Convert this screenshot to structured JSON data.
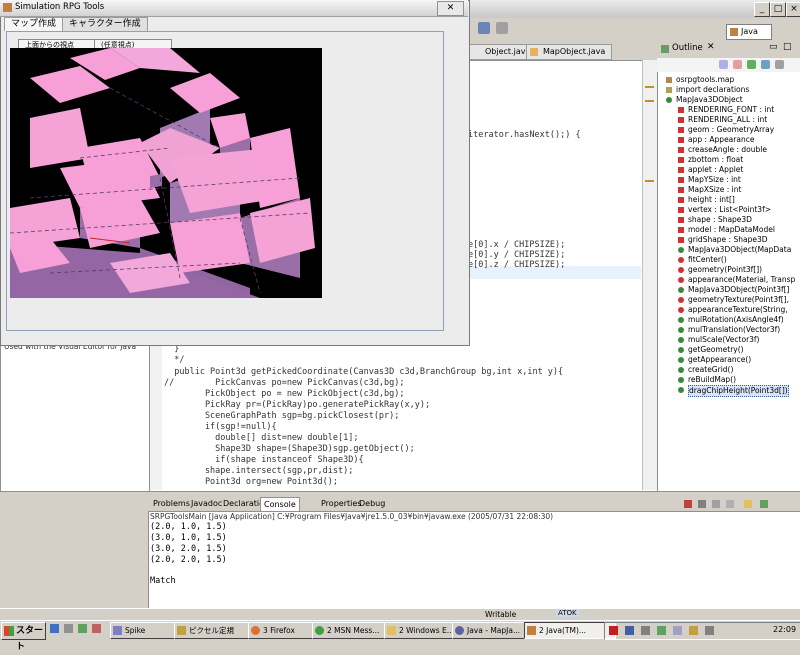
{
  "eclipse": {
    "title_icon": "java-perspective-icon",
    "perspective_label": "Java",
    "editor_tabs": [
      {
        "label": "Object.java"
      },
      {
        "label": "MapObject.java"
      }
    ],
    "code_fragment_top": "iterator.hasNext();) {",
    "code_middle": [
      "e[0].x / CHIPSIZE);",
      "e[0].y / CHIPSIZE);",
      "e[0].z / CHIPSIZE);"
    ],
    "code_lines": [
      "  }",
      "  */",
      "  public Point3d getPickedCoordinate(Canvas3D c3d,BranchGroup bg,int x,int y){",
      "//        PickCanvas po=new PickCanvas(c3d,bg);",
      "        PickObject po = new PickObject(c3d,bg);",
      "        PickRay pr=(PickRay)po.generatePickRay(x,y);",
      "        SceneGraphPath sgp=bg.pickClosest(pr);",
      "        if(sgp!=null){",
      "          double[] dist=new double[1];",
      "          Shape3D shape=(Shape3D)sgp.getObject();",
      "          if(shape instanceof Shape3D){",
      "        shape.intersect(sgp,pr,dist);",
      "        Point3d org=new Point3d();"
    ],
    "visual_editor_note": "Used with the Visual Editor for Java"
  },
  "outline": {
    "title": "Outline",
    "items": [
      {
        "label": "osrpgtools.map",
        "icon": "package-icon",
        "indent": 0,
        "color": "#b08850"
      },
      {
        "label": "import declarations",
        "icon": "imports-icon",
        "indent": 0,
        "color": "#b0a060"
      },
      {
        "label": "MapJava3DObject",
        "icon": "class-icon",
        "indent": 0,
        "color": "#3a8a3a"
      },
      {
        "label": "RENDERING_FONT : int",
        "icon": "static-field-icon",
        "indent": 1,
        "color": "#cc3333"
      },
      {
        "label": "RENDERING_ALL : int",
        "icon": "static-field-icon",
        "indent": 1,
        "color": "#cc3333"
      },
      {
        "label": "geom : GeometryArray",
        "icon": "private-field-icon",
        "indent": 1,
        "color": "#cc3333"
      },
      {
        "label": "app : Appearance",
        "icon": "private-field-icon",
        "indent": 1,
        "color": "#cc3333"
      },
      {
        "label": "creaseAngle : double",
        "icon": "private-field-icon",
        "indent": 1,
        "color": "#cc3333"
      },
      {
        "label": "zbottom : float",
        "icon": "private-field-icon",
        "indent": 1,
        "color": "#cc3333"
      },
      {
        "label": "applet : Applet",
        "icon": "private-field-icon",
        "indent": 1,
        "color": "#cc3333"
      },
      {
        "label": "MapYSize : int",
        "icon": "private-field-icon",
        "indent": 1,
        "color": "#cc3333"
      },
      {
        "label": "MapXSize : int",
        "icon": "private-field-icon",
        "indent": 1,
        "color": "#cc3333"
      },
      {
        "label": "height : int[]",
        "icon": "private-field-icon",
        "indent": 1,
        "color": "#cc3333"
      },
      {
        "label": "vertex : List<Point3f>",
        "icon": "private-field-icon",
        "indent": 1,
        "color": "#cc3333"
      },
      {
        "label": "shape : Shape3D",
        "icon": "private-field-icon",
        "indent": 1,
        "color": "#cc3333"
      },
      {
        "label": "model : MapDataModel",
        "icon": "private-field-icon",
        "indent": 1,
        "color": "#cc3333"
      },
      {
        "label": "gridShape : Shape3D",
        "icon": "private-field-icon",
        "indent": 1,
        "color": "#cc3333"
      },
      {
        "label": "MapJava3DObject(MapData",
        "icon": "constructor-icon",
        "indent": 1,
        "color": "#3a8a3a"
      },
      {
        "label": "fitCenter()",
        "icon": "private-method-icon",
        "indent": 1,
        "color": "#cc3333"
      },
      {
        "label": "geometry(Point3f[])",
        "icon": "private-method-icon",
        "indent": 1,
        "color": "#cc3333"
      },
      {
        "label": "appearance(Material, Transp",
        "icon": "private-method-icon",
        "indent": 1,
        "color": "#cc3333"
      },
      {
        "label": "MapJava3DObject(Point3f[]",
        "icon": "constructor-icon",
        "indent": 1,
        "color": "#3a8a3a"
      },
      {
        "label": "geometryTexture(Point3f[],",
        "icon": "private-method-icon",
        "indent": 1,
        "color": "#cc3333"
      },
      {
        "label": "appearanceTexture(String,",
        "icon": "private-method-icon",
        "indent": 1,
        "color": "#cc3333"
      },
      {
        "label": "mulRotation(AxisAngle4f)",
        "icon": "public-method-icon",
        "indent": 1,
        "color": "#3a8a3a"
      },
      {
        "label": "mulTranslation(Vector3f)",
        "icon": "public-method-icon",
        "indent": 1,
        "color": "#3a8a3a"
      },
      {
        "label": "mulScale(Vector3f)",
        "icon": "public-method-icon",
        "indent": 1,
        "color": "#3a8a3a"
      },
      {
        "label": "getGeometry()",
        "icon": "public-method-icon",
        "indent": 1,
        "color": "#3a8a3a"
      },
      {
        "label": "getAppearance()",
        "icon": "public-method-icon",
        "indent": 1,
        "color": "#3a8a3a"
      },
      {
        "label": "createGrid()",
        "icon": "public-method-icon",
        "indent": 1,
        "color": "#3a8a3a"
      },
      {
        "label": "reBuildMap()",
        "icon": "public-method-icon",
        "indent": 1,
        "color": "#3a8a3a"
      },
      {
        "label": "dragChipHeight(Point3d[])",
        "icon": "public-method-icon",
        "indent": 1,
        "color": "#3a8a3a",
        "selected": true
      }
    ]
  },
  "bottom_tabs": [
    {
      "label": "Problems"
    },
    {
      "label": "Javadoc"
    },
    {
      "label": "Declaration"
    },
    {
      "label": "Console",
      "active": true
    },
    {
      "label": "Properties"
    },
    {
      "label": "Debug"
    }
  ],
  "console": {
    "process": "SRPGToolsMain [Java Application] C:¥Program Files¥Java¥jre1.5.0_03¥bin¥javaw.exe (2005/07/31 22:08:30)",
    "lines": [
      "(2.0, 1.0, 1.5)",
      "(3.0, 1.0, 1.5)",
      "(3.0, 2.0, 1.5)",
      "(2.0, 2.0, 1.5)",
      "",
      "Match"
    ]
  },
  "status_bar": {
    "mode": "Writable",
    "ime": "ATOK"
  },
  "taskbar": {
    "start_label": "スタート",
    "tasks": [
      {
        "label": "Spike",
        "icon": "generic-app-icon"
      },
      {
        "label": "ピクセル定規",
        "icon": "ruler-icon"
      },
      {
        "label": "3 Firefox",
        "icon": "firefox-icon"
      },
      {
        "label": "2 MSN Mess...",
        "icon": "msn-icon"
      },
      {
        "label": "2 Windows E...",
        "icon": "folder-icon"
      },
      {
        "label": "Java - MapJa...",
        "icon": "eclipse-icon"
      },
      {
        "label": "2 Java(TM)...",
        "icon": "java-icon",
        "active": true
      }
    ],
    "clock": "22:09"
  },
  "rpg_window": {
    "title": "Simulation RPG Tools",
    "tabs": [
      {
        "label": "マップ作成",
        "active": true
      },
      {
        "label": "キャラクター作成",
        "active": false
      }
    ],
    "buttons": [
      {
        "label": "上面からの視点"
      },
      {
        "label": "(任意視点)"
      }
    ]
  }
}
